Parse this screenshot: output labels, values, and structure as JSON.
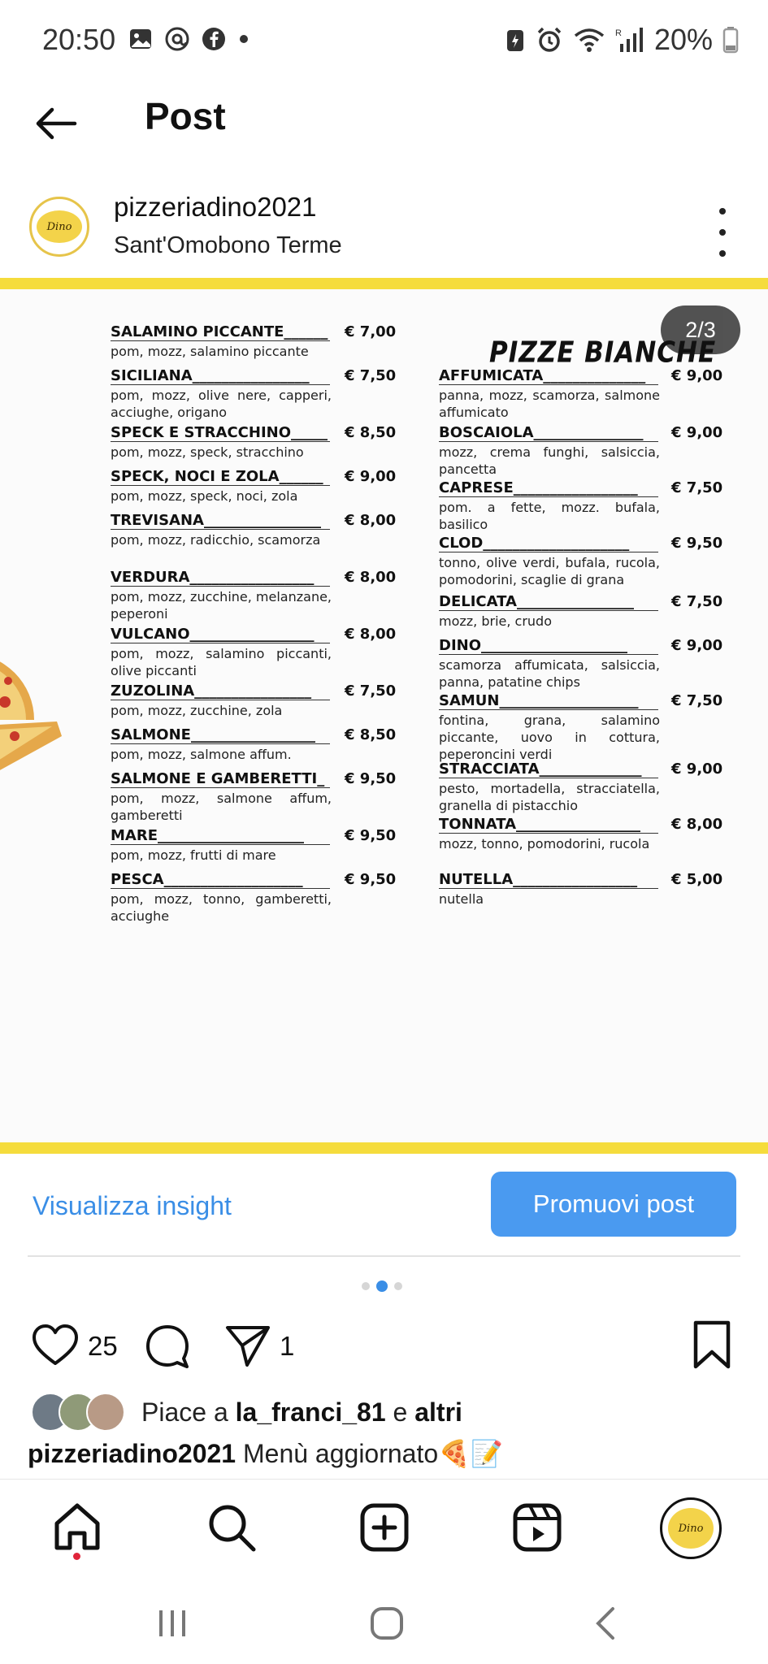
{
  "status_bar": {
    "time": "20:50",
    "battery": "20%",
    "left_icons": [
      "gallery-icon",
      "threads-icon",
      "facebook-icon",
      "dot-icon"
    ],
    "right_icons": [
      "battery-saver-icon",
      "alarm-icon",
      "wifi-icon",
      "signal-icon",
      "battery-icon"
    ]
  },
  "header": {
    "title": "Post"
  },
  "post": {
    "username": "pizzeriadino2021",
    "location": "Sant'Omobono Terme",
    "avatar_text": "Dino",
    "image": {
      "counter": "2/3",
      "section_heading": "PIZZE BIANCHE",
      "left_column": [
        {
          "name": "SALAMINO PICCANTE______",
          "price": "€ 7,00",
          "desc": "pom, mozz, salamino piccante"
        },
        {
          "name": "SICILIANA________________",
          "price": "€ 7,50",
          "desc": "pom, mozz, olive nere, capperi, acciughe, origano"
        },
        {
          "name": "SPECK E STRACCHINO_____",
          "price": "€ 8,50",
          "desc": "pom, mozz, speck, stracchino"
        },
        {
          "name": "SPECK, NOCI E ZOLA______",
          "price": "€ 9,00",
          "desc": "pom, mozz, speck, noci, zola"
        },
        {
          "name": "TREVISANA________________",
          "price": "€ 8,00",
          "desc": "pom, mozz, radicchio, scamorza"
        },
        {
          "name": "VERDURA_________________",
          "price": "€ 8,00",
          "desc": "pom, mozz, zucchine, melanzane, peperoni"
        },
        {
          "name": "VULCANO_________________",
          "price": "€ 8,00",
          "desc": "pom, mozz, salamino piccanti, olive piccanti"
        },
        {
          "name": "ZUZOLINA________________",
          "price": "€ 7,50",
          "desc": "pom, mozz, zucchine, zola"
        },
        {
          "name": "SALMONE_________________",
          "price": "€ 8,50",
          "desc": "pom, mozz, salmone affum."
        },
        {
          "name": "SALMONE E GAMBERETTI_",
          "price": "€ 9,50",
          "desc": "pom, mozz, salmone affum, gamberetti"
        },
        {
          "name": "MARE____________________",
          "price": "€ 9,50",
          "desc": "pom, mozz, frutti di mare"
        },
        {
          "name": "PESCA___________________",
          "price": "€ 9,50",
          "desc": "pom, mozz, tonno, gamberetti, acciughe"
        }
      ],
      "right_column": [
        {
          "name": "AFFUMICATA______________",
          "price": "€ 9,00",
          "desc": "panna, mozz, scamorza, salmone affumicato"
        },
        {
          "name": "BOSCAIOLA_______________",
          "price": "€ 9,00",
          "desc": "mozz, crema funghi, salsiccia, pancetta"
        },
        {
          "name": "CAPRESE_________________",
          "price": "€ 7,50",
          "desc": "pom. a fette, mozz. bufala, basilico"
        },
        {
          "name": "CLOD____________________",
          "price": "€ 9,50",
          "desc": "tonno, olive verdi, bufala, rucola, pomodorini, scaglie di grana"
        },
        {
          "name": "DELICATA________________",
          "price": "€ 7,50",
          "desc": "mozz, brie, crudo"
        },
        {
          "name": "DINO____________________",
          "price": "€ 9,00",
          "desc": "scamorza affumicata, salsiccia, panna, patatine chips"
        },
        {
          "name": "SAMUN___________________",
          "price": "€ 7,50",
          "desc": "fontina, grana, salamino piccante, uovo in cottura, peperoncini verdi"
        },
        {
          "name": "STRACCIATA______________",
          "price": "€ 9,00",
          "desc": "pesto, mortadella, stracciatella, granella di pistacchio"
        },
        {
          "name": "TONNATA_________________",
          "price": "€ 8,00",
          "desc": "mozz, tonno, pomodorini, rucola"
        },
        {
          "name": "NUTELLA_________________",
          "price": "€ 5,00",
          "desc": "nutella"
        }
      ]
    },
    "insight_label": "Visualizza insight",
    "promote_label": "Promuovi post",
    "carousel": {
      "count": 3,
      "active_index": 1
    },
    "likes_count": "25",
    "shares_count": "1",
    "likes_prefix": "Piace a ",
    "likes_user": "la_franci_81",
    "likes_middle": " e ",
    "likes_others": "altri",
    "caption_user": "pizzeriadino2021",
    "caption_text": " Menù aggiornato🍕📝"
  },
  "bottom_nav": [
    "home-icon",
    "search-icon",
    "create-icon",
    "reels-icon",
    "profile-avatar"
  ],
  "colors": {
    "accent_blue": "#4a9af0",
    "link_blue": "#3a8ee6",
    "menu_yellow": "#f5dc3c",
    "notification_red": "#e0243a"
  }
}
